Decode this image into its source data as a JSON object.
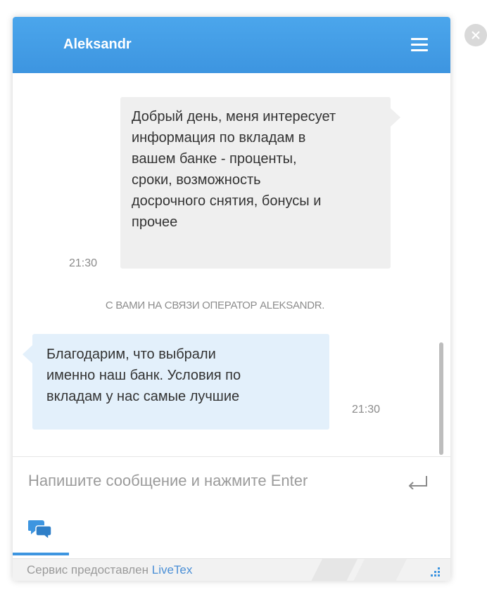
{
  "header": {
    "operator_name": "Aleksandr",
    "menu_icon": "hamburger-menu-icon"
  },
  "messages": {
    "client": {
      "text": "Добрый день, меня интересует\nинформация по вкладам в\nвашем банке - проценты,\nсроки, возможность\nдосрочного снятия, бонусы и\nпрочее",
      "time": "21:30"
    },
    "system": "С ВАМИ НА СВЯЗИ ОПЕРАТОР ALEKSANDR.",
    "operator": {
      "text": "Благодарим, что выбрали\nименно наш банк. Условия по\nвкладам у нас самые лучшие",
      "time": "21:30"
    }
  },
  "composer": {
    "placeholder": "Напишите сообщение и нажмите Enter",
    "value": "",
    "send_icon": "enter-return-icon"
  },
  "tabs": {
    "chat_icon": "chat-bubbles-icon"
  },
  "footer": {
    "service_text": "Сервис предоставлен ",
    "brand": "LiveTex",
    "resize_icon": "resize-grip-icon"
  },
  "close_icon": "close-icon",
  "colors": {
    "header": "#3d95e0",
    "client_bubble": "#efefef",
    "operator_bubble": "#e3f0fb",
    "brand_link": "#4a8fd6"
  }
}
